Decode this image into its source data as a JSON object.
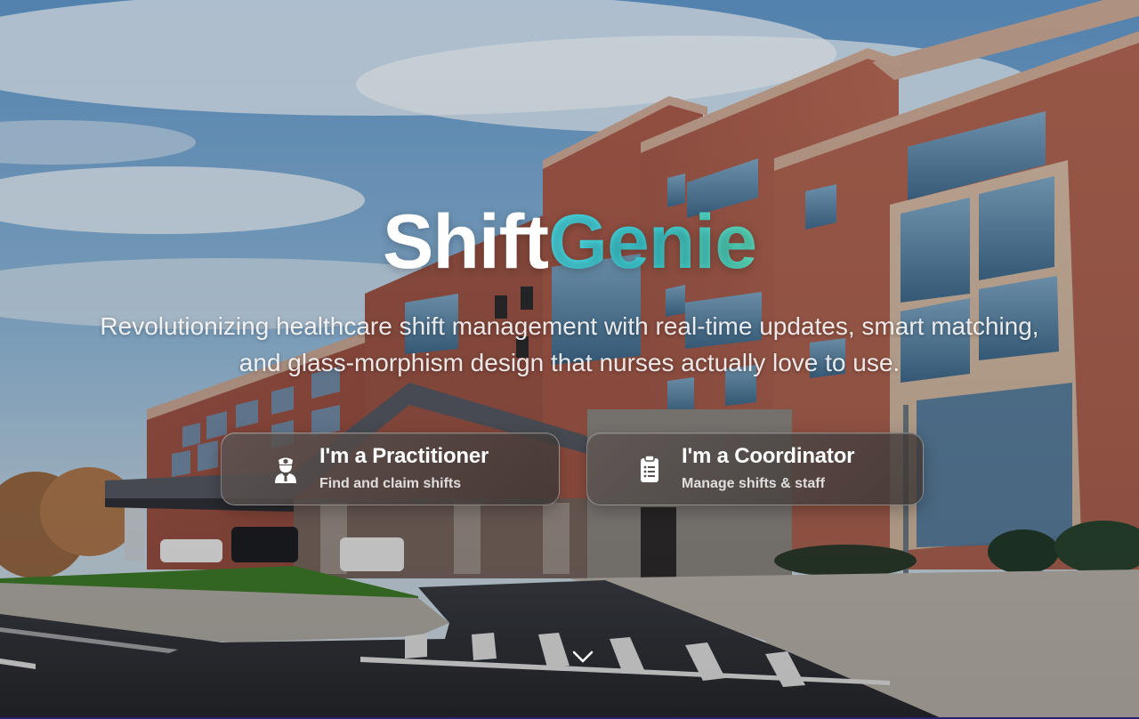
{
  "brand": {
    "name_part1": "Shift",
    "name_part2": "Genie",
    "accent_gradient": [
      "#4fe3ee",
      "#5ee3c2"
    ]
  },
  "hero": {
    "subtitle": "Revolutionizing healthcare shift management with real-time updates, smart matching, and glass-morphism design that nurses actually love to use.",
    "background": "hospital-building-photo"
  },
  "roles": [
    {
      "title": "I'm a Practitioner",
      "subtitle": "Find and claim shifts",
      "icon": "nurse-icon"
    },
    {
      "title": "I'm a Coordinator",
      "subtitle": "Manage shifts & staff",
      "icon": "clipboard-icon"
    }
  ],
  "scroll_indicator": {
    "icon": "chevron-down-icon"
  }
}
